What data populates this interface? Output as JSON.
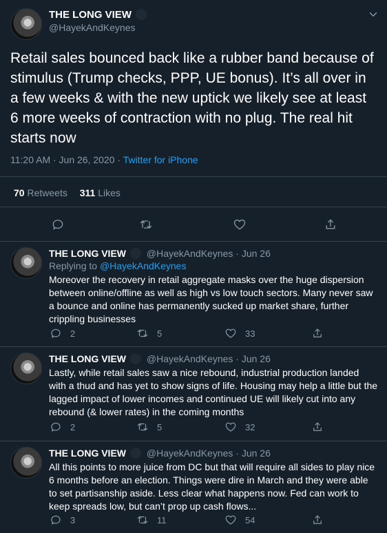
{
  "main_tweet": {
    "author_name": "THE LONG VIEW",
    "handle": "@HayekAndKeynes",
    "text": "Retail sales bounced back like a rubber band because of stimulus (Trump checks, PPP, UE bonus). It’s all over in a few weeks & with the new uptick we likely see at least 6 more weeks of contraction with no plug. The real hit starts now",
    "timestamp": "11:20 AM · Jun 26, 2020",
    "source_sep": " · ",
    "source": "Twitter for iPhone",
    "retweets_count": "70",
    "retweets_label": "Retweets",
    "likes_count": "311",
    "likes_label": "Likes"
  },
  "replies": [
    {
      "author_name": "THE LONG VIEW",
      "handle": "@HayekAndKeynes",
      "date": "· Jun 26",
      "replying_label": "Replying to",
      "replying_handle": "@HayekAndKeynes",
      "text": "Moreover the recovery in retail aggregate masks over the huge dispersion between online/offline as well as high vs low touch sectors. Many never saw a bounce and online has  permanently sucked up market share, further crippling businesses",
      "reply_count": "2",
      "retweet_count": "5",
      "like_count": "33"
    },
    {
      "author_name": "THE LONG VIEW",
      "handle": "@HayekAndKeynes",
      "date": "· Jun 26",
      "text": "Lastly, while retail sales saw a nice rebound, industrial production landed with a thud and has yet to show signs of life. Housing may help a little but the lagged impact of lower incomes and continued UE will likely cut into any rebound (& lower rates) in the coming months",
      "reply_count": "2",
      "retweet_count": "5",
      "like_count": "32"
    },
    {
      "author_name": "THE LONG VIEW",
      "handle": "@HayekAndKeynes",
      "date": "· Jun 26",
      "text": "All this points to more juice from DC but that will require all sides to play nice 6 months before an election. Things were dire in March and they were able to set partisanship aside. Less clear what happens now. Fed can work to keep spreads low, but can’t prop up cash flows...",
      "reply_count": "3",
      "retweet_count": "11",
      "like_count": "54"
    }
  ],
  "icons": {
    "reply": "reply-icon",
    "retweet": "retweet-icon",
    "like": "heart-icon",
    "share": "share-icon",
    "more": "chevron-down-icon",
    "verified_badge": "badge-icon"
  },
  "colors": {
    "background": "#15202b",
    "text": "#ffffff",
    "muted": "#8899a6",
    "accent": "#1da1f2",
    "divider": "#38444d"
  }
}
